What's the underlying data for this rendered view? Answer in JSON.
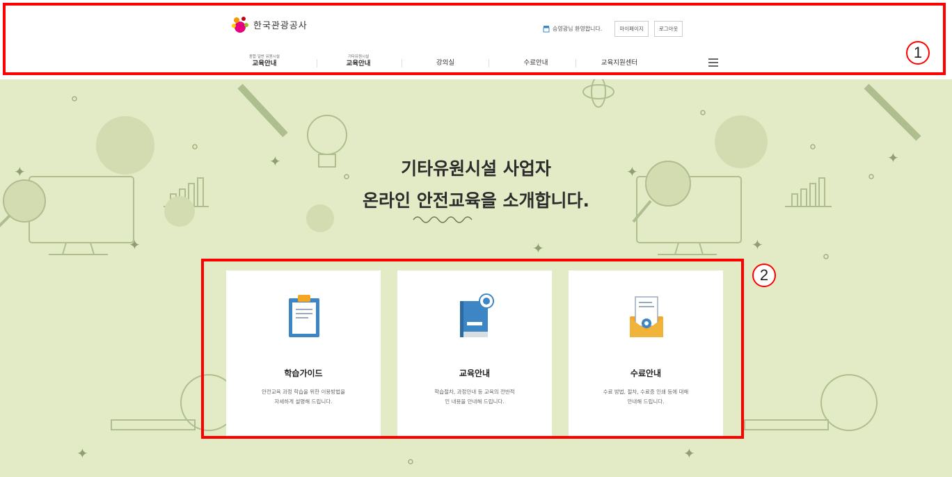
{
  "header": {
    "logo_text": "한국관광공사",
    "welcome": "승영광님 환영합니다.",
    "mypage_label": "마이페이지",
    "logout_label": "로그아웃",
    "nav": [
      {
        "small": "종합·일반 유원시설",
        "big": "교육안내"
      },
      {
        "small": "기타유원시설",
        "big": "교육안내"
      },
      {
        "small": "",
        "big": "강의실"
      },
      {
        "small": "",
        "big": "수료안내"
      },
      {
        "small": "",
        "big": "교육지원센터"
      }
    ]
  },
  "hero": {
    "line1": "기타유원시설 사업자",
    "line2": "온라인 안전교육을 소개합니다."
  },
  "cards": [
    {
      "title": "학습가이드",
      "desc1": "안전교육 과정 학습을 위한 이용방법을",
      "desc2": "자세하게 설명해 드립니다.",
      "icon": "clipboard-icon"
    },
    {
      "title": "교육안내",
      "desc1": "학습절차, 과정안내 등 교육의 전반적",
      "desc2": "인 내용을 안내해 드립니다.",
      "icon": "book-icon"
    },
    {
      "title": "수료안내",
      "desc1": "수료 방법, 절차, 수료증 인쇄 등에 대해",
      "desc2": "안내해 드립니다.",
      "icon": "certificate-icon"
    }
  ],
  "annotations": {
    "one": "1",
    "two": "2"
  },
  "colors": {
    "accent_red": "#ff0000",
    "background": "#e3ebc6",
    "icon_blue": "#3d86c6",
    "icon_orange": "#f5a623"
  }
}
